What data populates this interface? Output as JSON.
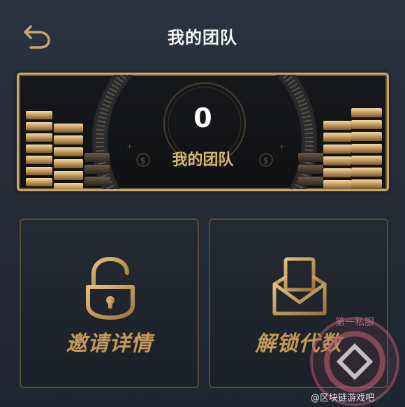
{
  "header": {
    "title": "我的团队",
    "back_icon": "back-arrow-icon"
  },
  "team": {
    "count": "0",
    "label": "我的团队"
  },
  "cards": [
    {
      "label": "邀请详情",
      "icon": "unlock-padlock-icon"
    },
    {
      "label": "解锁代数",
      "icon": "envelope-letter-icon"
    }
  ],
  "watermark": {
    "ring_text": "第一私服",
    "footer_text": "@区块链游戏吧"
  },
  "colors": {
    "gold": "#c9a767",
    "gold_text": "#d9b874",
    "background": "#242c38",
    "watermark": "#b0586a"
  }
}
